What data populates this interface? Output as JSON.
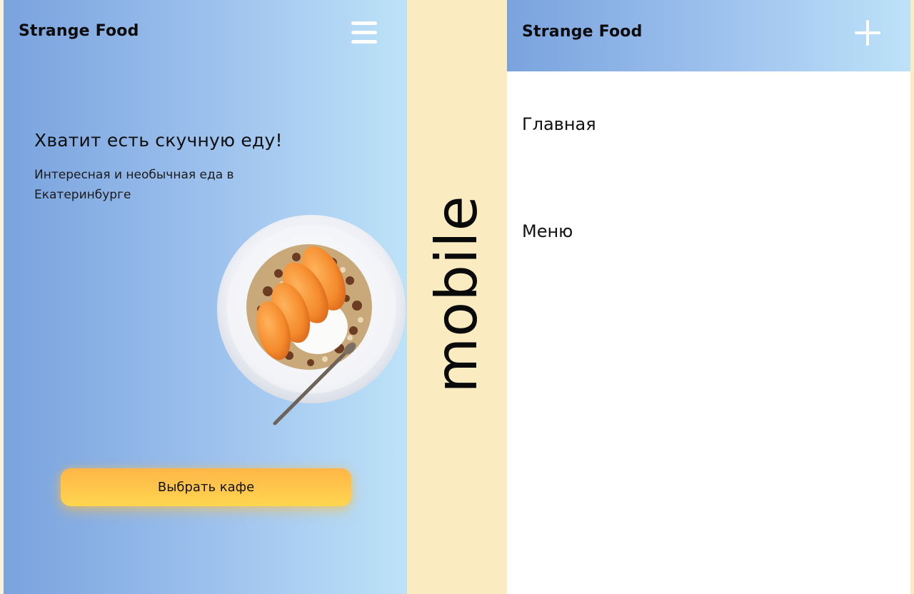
{
  "home": {
    "brand": "Strange Food",
    "menu_icon": "hamburger-menu-icon",
    "hero_title": "Хватит есть скучную еду!",
    "hero_subtitle": "Интересная и необычная еда в Екатеринбурге",
    "image": "muesli-bowl-with-peaches-and-spoon",
    "cta_label": "Выбрать кафе"
  },
  "separator_label": "mobile",
  "menu_screen": {
    "brand": "Strange Food",
    "close_icon": "plus-close-icon",
    "items": [
      {
        "label": "Главная"
      },
      {
        "label": "Меню"
      }
    ]
  },
  "colors": {
    "gradient_start": "#7aa3de",
    "gradient_end": "#bde2f8",
    "background": "#faecc0",
    "button_top": "#ffb647",
    "button_bottom": "#ffd54f",
    "text": "#0b0b0b",
    "icon": "#ffffff"
  }
}
